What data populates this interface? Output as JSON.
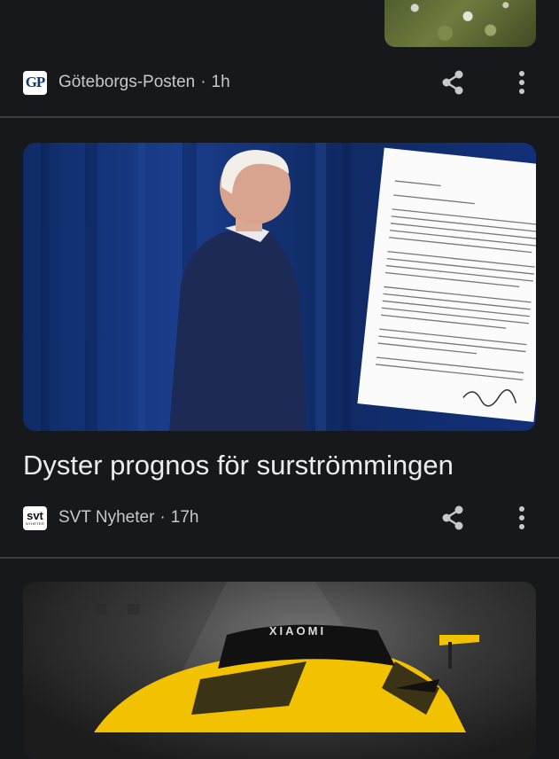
{
  "feed": {
    "items": [
      {
        "source": "Göteborgs-Posten",
        "separator": "·",
        "age": "1h",
        "logo_text": "GP",
        "icons": {
          "share": "share-icon",
          "more": "more-vert-icon"
        }
      },
      {
        "headline": "Dyster prognos för surströmmingen",
        "source": "SVT Nyheter",
        "separator": "·",
        "age": "17h",
        "logo_text": "svt",
        "logo_subtext": "NYHETER",
        "icons": {
          "share": "share-icon",
          "more": "more-vert-icon"
        }
      },
      {
        "image_text": "XIAOMI"
      }
    ]
  },
  "colors": {
    "background": "#17181c",
    "divider": "#3a3c40",
    "text_primary": "#ececee",
    "text_secondary": "#c6c8cc",
    "icon": "#c6c8cc",
    "car_yellow": "#f2c100"
  }
}
